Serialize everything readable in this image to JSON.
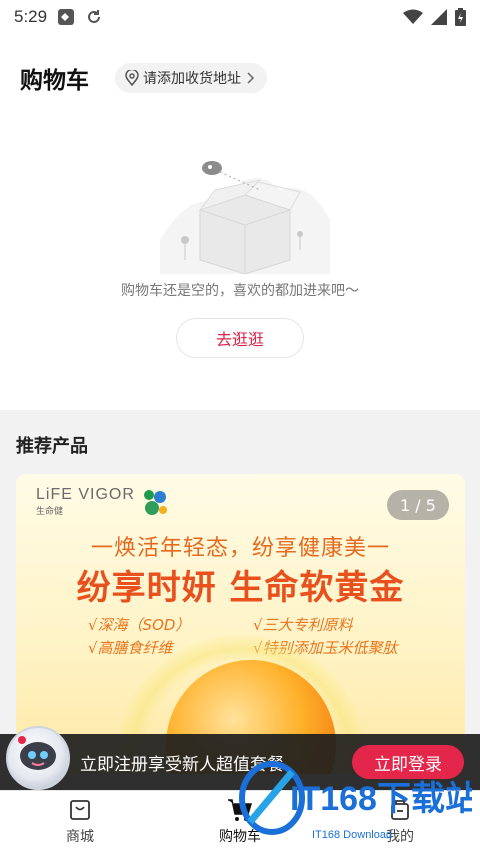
{
  "status_bar": {
    "time": "5:29"
  },
  "header": {
    "title": "购物车",
    "address_label": "请添加收货地址"
  },
  "empty_cart": {
    "message": "购物车还是空的，喜欢的都加进来吧～",
    "button_label": "去逛逛"
  },
  "recommend": {
    "title": "推荐产品",
    "banner": {
      "logo_text": "LiFE VIGOR",
      "logo_sub": "生命健",
      "page_indicator": "1 / 5",
      "tagline": "一焕活年轻态，纷享健康美一",
      "headline": "纷享时妍 生命软黄金",
      "features": [
        "√深海（SOD）",
        "√三大专利原料",
        "√高膳食纤维",
        "√特别添加玉米低聚肽"
      ]
    }
  },
  "promo": {
    "text": "立即注册享受新人超值套餐",
    "login_label": "立即登录"
  },
  "bottom_nav": {
    "items": [
      {
        "label": "商城",
        "icon": "shopping-bag-icon"
      },
      {
        "label": "购物车",
        "icon": "cart-icon"
      },
      {
        "label": "我的",
        "icon": "profile-icon"
      }
    ]
  },
  "watermark": {
    "brand": "IT168下载站",
    "sub": "IT168 Download"
  },
  "colors": {
    "accent": "#e3264a",
    "banner_orange": "#e8501e"
  }
}
